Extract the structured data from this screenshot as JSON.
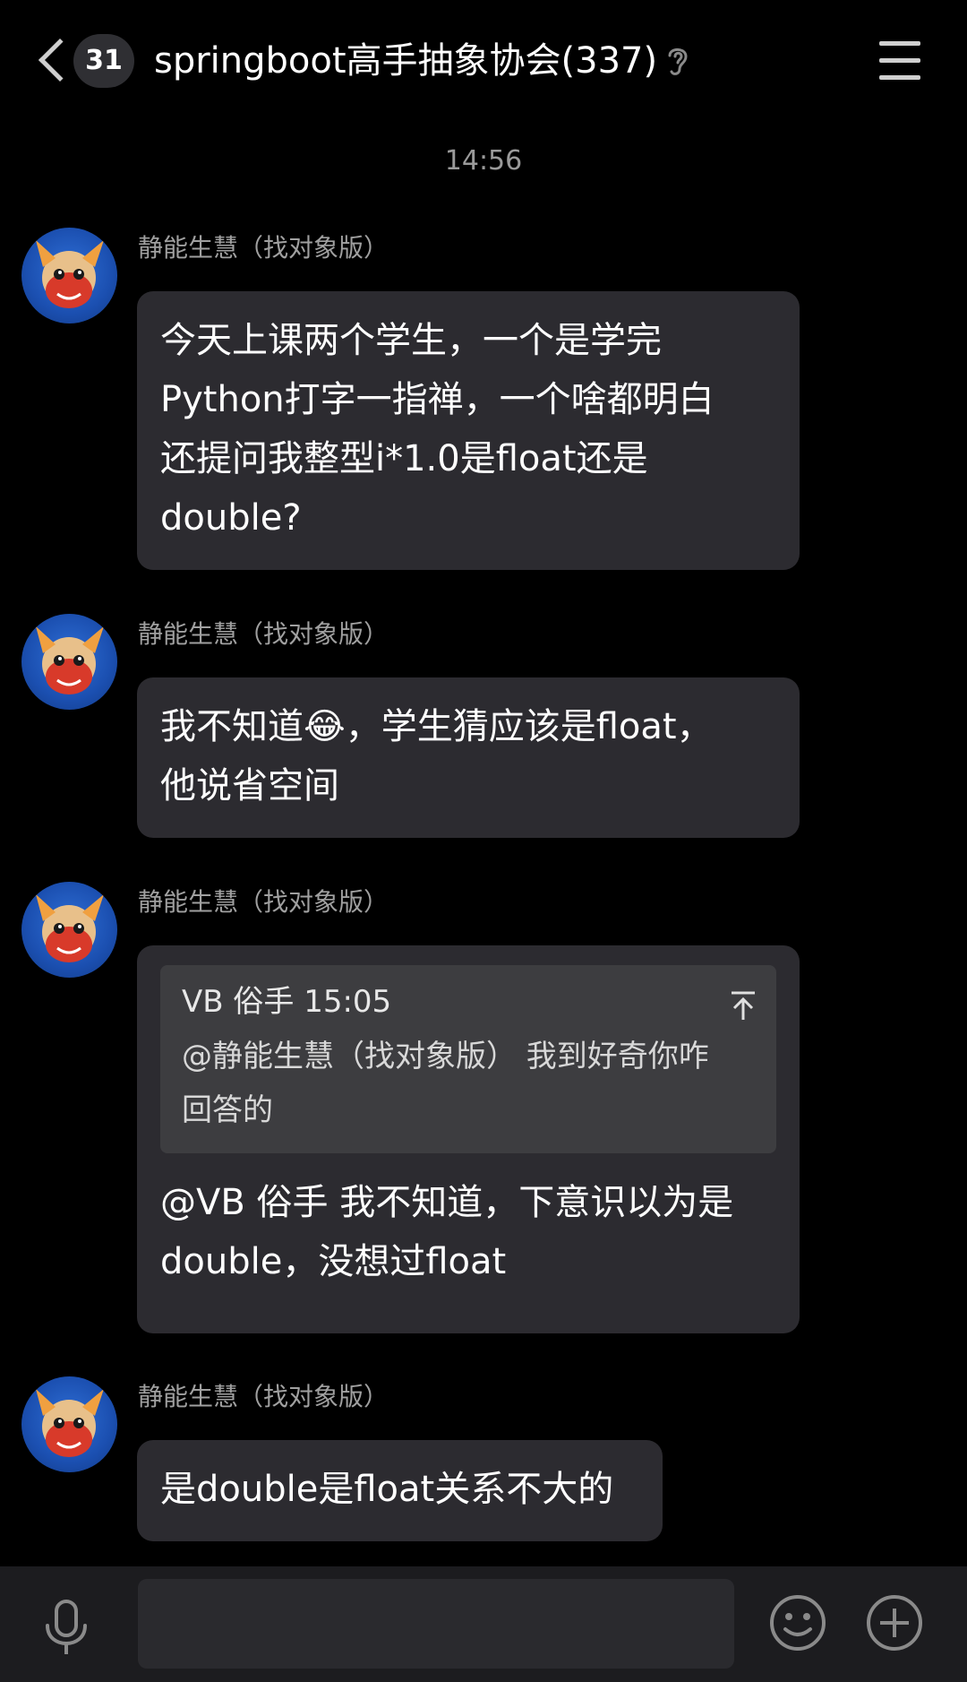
{
  "header": {
    "unread_count": "31",
    "title": "springboot高手抽象协会(337)"
  },
  "timestamp": "14:56",
  "messages": [
    {
      "sender": "静能生慧（找对象版）",
      "lines": [
        "今天上课两个学生，一个是学完",
        "Python打字一指禅，一个啥都明白",
        "还提问我整型i*1.0是float还是",
        "double?"
      ]
    },
    {
      "sender": "静能生慧（找对象版）",
      "lines": [
        "我不知道😂，学生猜应该是float，",
        "他说省空间"
      ]
    },
    {
      "sender": "静能生慧（找对象版）",
      "quote": {
        "author_time": "VB 俗手 15:05",
        "lines": [
          "@静能生慧（找对象版） 我到好奇你咋",
          "回答的"
        ]
      },
      "lines": [
        "@VB 俗手 我不知道，下意识以为是",
        "double，没想过float"
      ]
    },
    {
      "sender": "静能生慧（找对象版）",
      "lines": [
        "是double是float关系不大的"
      ]
    }
  ],
  "input": {
    "value": ""
  },
  "icons": {
    "back": "chevron-left-icon",
    "ear": "ear-icon",
    "menu": "menu-icon",
    "quote_jump": "arrow-up-to-top-icon",
    "voice": "microphone-icon",
    "emoji": "smiley-icon",
    "plus": "plus-circle-icon"
  },
  "colors": {
    "background": "#000000",
    "bubble": "#2c2b30",
    "quote": "#3d3d40",
    "secondary_text": "#a0a0a0"
  }
}
